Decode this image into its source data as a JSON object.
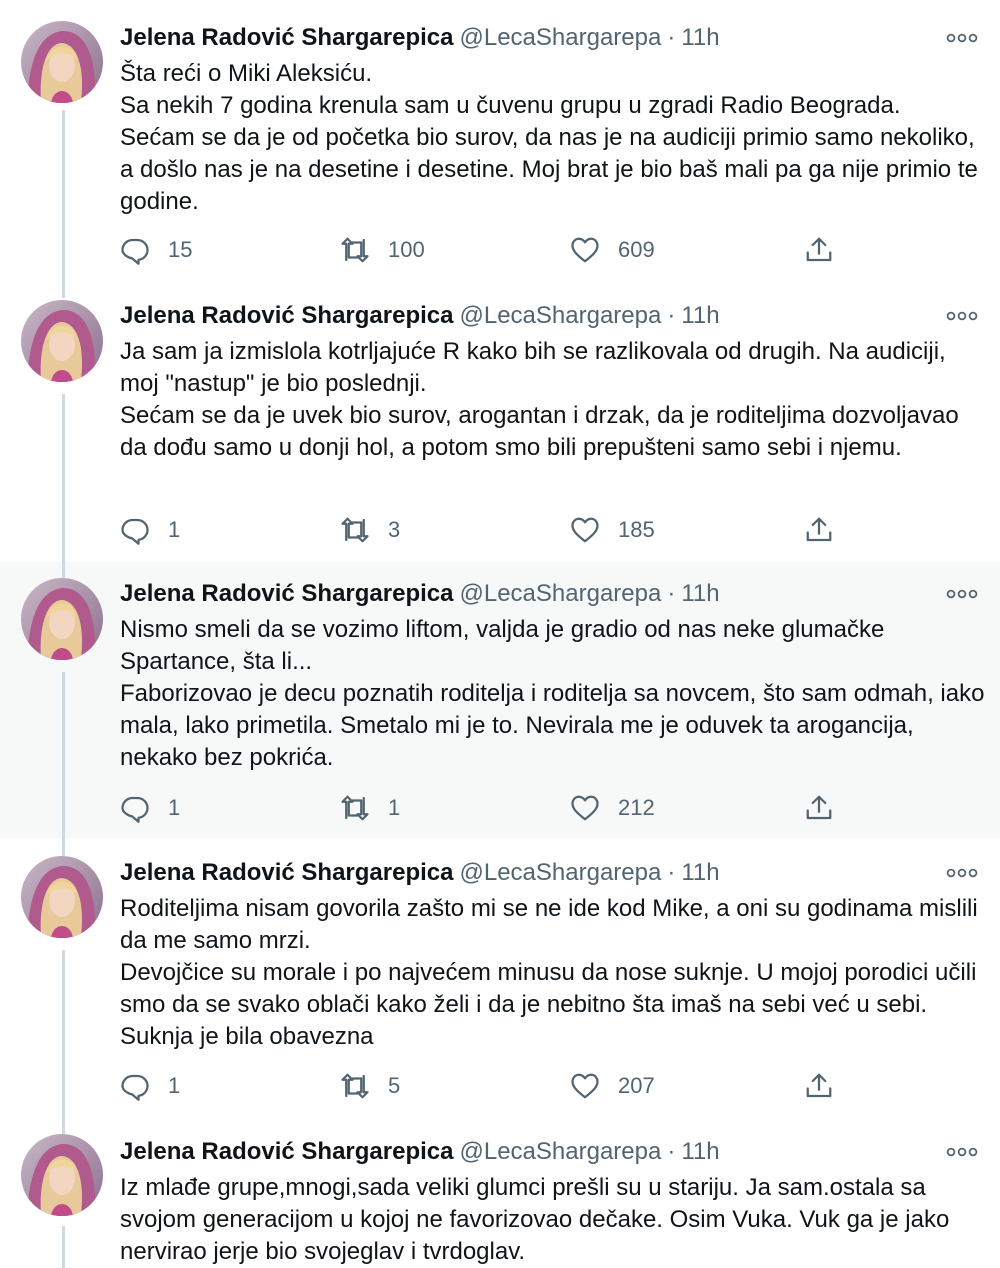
{
  "author": {
    "name": "Jelena Radović Shargarepica",
    "handle": "@LecaShargarepa",
    "separator": "·",
    "time": "11h"
  },
  "icons": {
    "more": "more-horizontal-icon",
    "reply": "reply-icon",
    "retweet": "retweet-icon",
    "like": "heart-icon",
    "share": "share-icon"
  },
  "colors": {
    "text": "#0f1419",
    "muted": "#536471",
    "thread_line": "#cfd9de",
    "highlight_bg": "#f7f9f9"
  },
  "tweets": [
    {
      "lines": [
        "Šta reći o Miki Aleksiću.",
        "Sa nekih 7 godina krenula sam u čuvenu grupu u zgradi Radio Beograda.",
        "Sećam se da je od početka bio surov, da nas je na audiciji primio samo nekoliko, a došlo nas je na desetine i desetine. Moj brat je bio baš mali pa ga nije primio te godine."
      ],
      "replies": "15",
      "retweets": "100",
      "likes": "609"
    },
    {
      "lines": [
        "Ja sam ja izmislola kotrljajuće R kako bih se razlikovala od drugih. Na audiciji, moj \"nastup\" je bio poslednji.",
        "Sećam se da je uvek bio surov, arogantan i drzak, da je roditeljima dozvoljavao da dođu samo u donji hol, a potom smo bili prepušteni samo sebi i njemu."
      ],
      "replies": "1",
      "retweets": "3",
      "likes": "185"
    },
    {
      "lines": [
        "Nismo smeli da se vozimo liftom, valjda je gradio od nas neke glumačke Spartance, šta li...",
        "Faborizovao je decu poznatih roditelja i roditelja sa novcem, što sam odmah, iako mala, lako primetila. Smetalo mi je to. Nevirala me je oduvek ta arogancija, nekako bez pokrića."
      ],
      "replies": "1",
      "retweets": "1",
      "likes": "212"
    },
    {
      "lines": [
        "Roditeljima nisam govorila zašto mi se ne ide kod Mike, a oni su godinama mislili da me samo mrzi.",
        "Devojčice su morale i po najvećem minusu da nose suknje. U mojoj porodici učili smo da se svako oblači kako želi i da je nebitno šta imaš na sebi već u sebi. Suknja je bila obavezna"
      ],
      "replies": "1",
      "retweets": "5",
      "likes": "207"
    },
    {
      "lines": [
        "Iz mlađe grupe,mnogi,sada veliki glumci prešli su u stariju. Ja sam.ostala sa svojom generacijom u kojoj ne favorizovao dečake. Osim Vuka. Vuk ga je jako nervirao jerje bio svojeglav i tvrdoglav."
      ]
    }
  ]
}
